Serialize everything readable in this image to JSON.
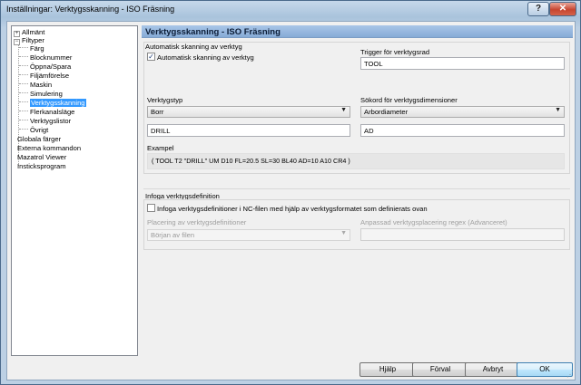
{
  "window": {
    "title": "Inställningar: Verktygsskanning - ISO Fräsning",
    "help": "?",
    "close": "✕"
  },
  "tree": {
    "items": [
      {
        "label": "Allmänt",
        "expander": "+"
      },
      {
        "label": "Filtyper",
        "expander": "−"
      },
      {
        "label": "Färg"
      },
      {
        "label": "Blocknummer"
      },
      {
        "label": "Öppna/Spara"
      },
      {
        "label": "Filjämförelse"
      },
      {
        "label": "Maskin"
      },
      {
        "label": "Simulering"
      },
      {
        "label": "Verktygsskanning",
        "selected": true
      },
      {
        "label": "Flerkanalsläge"
      },
      {
        "label": "Verktygslistor"
      },
      {
        "label": "Övrigt"
      },
      {
        "label": "Globala färger"
      },
      {
        "label": "Externa kommandon"
      },
      {
        "label": "Mazatrol Viewer"
      },
      {
        "label": "Insticksprogram"
      }
    ]
  },
  "page": {
    "header": "Verktygsskanning - ISO Fräsning",
    "auto": {
      "section_label": "Automatisk skanning av verktyg",
      "checkbox_label": "Automatisk skanning av verktyg",
      "checked": true,
      "checkmark": "✓",
      "trigger_label": "Trigger för verktygsrad",
      "trigger_value": "TOOL",
      "tooltype_label": "Verktygstyp",
      "tooltype_value": "Borr",
      "searchword_label": "Sökord för verktygsdimensioner",
      "searchword_value": "Arbordiameter",
      "tooltype_text": "DRILL",
      "searchword_text": "AD",
      "example_label": "Exampel",
      "example_text": "( TOOL T2 \"DRILL\" UM D10 FL=20.5 SL=30 BL40 AD=10 A10 CR4 )"
    },
    "insert": {
      "section_label": "Infoga verktygsdefinition",
      "checkbox_label": "Infoga verktygsdefinitioner i NC-filen med hjälp av verktygsformatet som definierats ovan",
      "checked": false,
      "placement_label": "Placering av verktygsdefinitioner",
      "placement_value": "Början av filen",
      "regex_label": "Anpassad verktygsplacering regex (Advanceret)",
      "regex_value": ""
    }
  },
  "buttons": {
    "help": "Hjälp",
    "default": "Förval",
    "cancel": "Avbryt",
    "ok": "OK"
  },
  "icons": {
    "dropdown": "▼",
    "grip": "⋰"
  }
}
